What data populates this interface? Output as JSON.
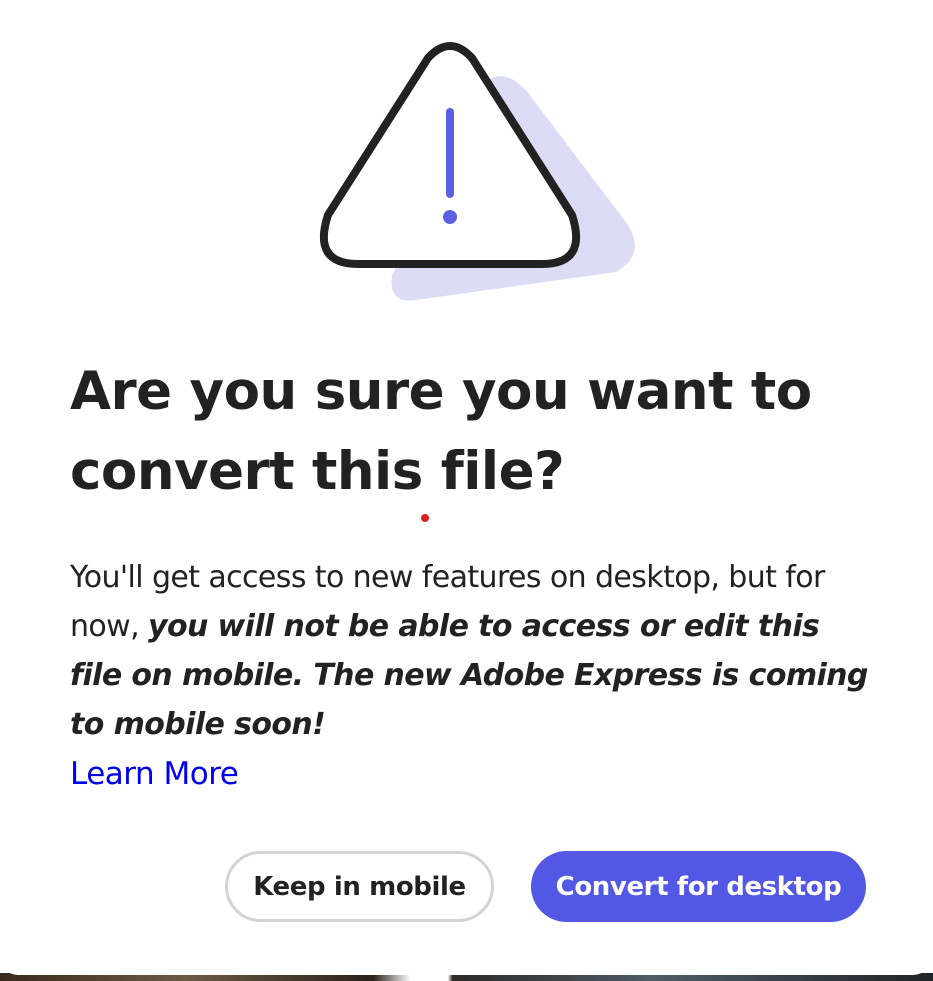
{
  "dialog": {
    "title": "Are you sure you want to convert this file?",
    "body_prefix": "You'll get access to new features on desktop, but for now, ",
    "body_emphasis": "you will not be able to access or edit this file on mobile. The new Adobe Express is coming to mobile soon!",
    "learn_more_label": "Learn More",
    "illustration_icon": "warning-triangle-icon"
  },
  "actions": {
    "keep_label": "Keep in mobile",
    "convert_label": "Convert for desktop"
  },
  "colors": {
    "primary_button": "#5258e4",
    "accent_exclamation": "#5c5fe0",
    "shadow_shape": "#dcdcf6",
    "link": "#0000ee",
    "text": "#222222"
  }
}
